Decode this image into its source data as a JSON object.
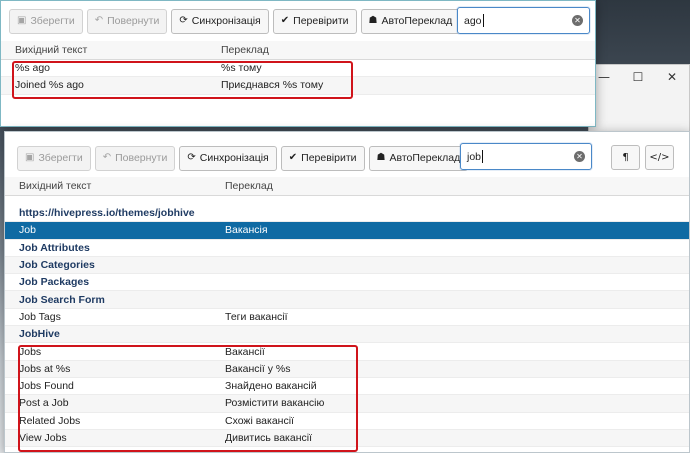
{
  "window_controls": {
    "minimize": "—",
    "maximize": "☐",
    "close": "✕"
  },
  "toolbar": {
    "save_label": "Зберегти",
    "revert_label": "Повернути",
    "sync_label": "Синхронізація",
    "check_label": "Перевірити",
    "autotranslate_label": "АвтоПереклад",
    "pilcrow_label": "¶",
    "code_label": "</>"
  },
  "top_window": {
    "search_value": "ago",
    "columns": [
      "Вихідний текст",
      "Переклад"
    ],
    "rows": [
      {
        "source": "%s ago",
        "translation": "%s тому"
      },
      {
        "source": "Joined %s ago",
        "translation": "Приєднався %s тому"
      }
    ]
  },
  "bottom_window": {
    "search_value": "job",
    "columns": [
      "Вихідний текст",
      "Переклад"
    ],
    "rows": [
      {
        "source": "https://hivepress.io/themes/jobhive",
        "translation": ""
      },
      {
        "source": "Job",
        "translation": "Вакансія"
      },
      {
        "source": "Job Attributes",
        "translation": ""
      },
      {
        "source": "Job Categories",
        "translation": ""
      },
      {
        "source": "Job Packages",
        "translation": ""
      },
      {
        "source": "Job Search Form",
        "translation": ""
      },
      {
        "source": "Job Tags",
        "translation": "Теги вакансії"
      },
      {
        "source": "JobHive",
        "translation": ""
      },
      {
        "source": "Jobs",
        "translation": "Вакансії"
      },
      {
        "source": "Jobs at %s",
        "translation": "Вакансії у %s"
      },
      {
        "source": "Jobs Found",
        "translation": "Знайдено вакансій"
      },
      {
        "source": "Post a Job",
        "translation": "Розмістити вакансію"
      },
      {
        "source": "Related Jobs",
        "translation": "Схожі вакансії"
      },
      {
        "source": "View Jobs",
        "translation": "Дивитись вакансії"
      }
    ]
  },
  "icons": [
    "save-icon",
    "undo-icon",
    "sync-icon",
    "check-icon",
    "robot-icon",
    "clear-search-icon",
    "pilcrow-icon",
    "code-icon"
  ],
  "colors": {
    "selected_row": "#0f6aa3",
    "highlight_box": "#d0141b",
    "untranslated_text": "#1f3b63",
    "search_focus": "#4a88c8"
  }
}
